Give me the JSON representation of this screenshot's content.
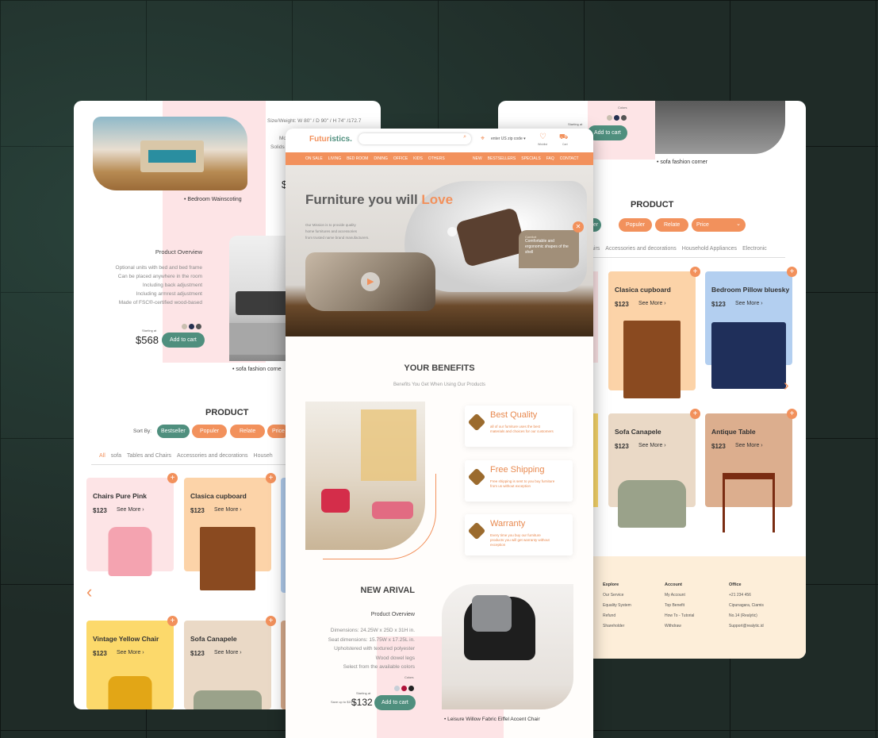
{
  "left": {
    "spec_text": "Size/Weight: W 80\" / D 90\" / H 74\" /172.7",
    "spec_partial_1": "Mo",
    "spec_partial_2": "Solids",
    "price_partial": "$",
    "bedroom_caption": "• Bedroom Wainscoting",
    "overview_title": "Product Overview",
    "overview_lines": [
      "Optional units with bed and bed frame",
      "Can be placed anywhere in the room",
      "Including back adjustment",
      "Including armrest adjustment",
      "Made of FSC®-certified wood-based"
    ],
    "starting_at": "Starting at",
    "price": "$568",
    "add_to_cart": "Add to cart",
    "sofa_caption": "• sofa fashion corne",
    "product_title": "PRODUCT",
    "sort_by": "Sort By:",
    "sort_buttons": [
      "Bestseller",
      "Populer",
      "Relate",
      "Price"
    ],
    "tabs": [
      "All",
      "sofa",
      "Tables and Chairs",
      "Accessories and decorations",
      "Househ"
    ],
    "products": [
      {
        "name": "Chairs Pure Pink",
        "price": "$123",
        "see": "See More ›"
      },
      {
        "name": "Clasica cupboard",
        "price": "$123",
        "see": "See More ›"
      },
      {
        "name": "Vintage Yellow Chair",
        "price": "$123",
        "see": "See More ›"
      },
      {
        "name": "Sofa Canapele",
        "price": "$123",
        "see": "See More ›"
      }
    ],
    "arrow": "‹"
  },
  "center": {
    "logo_a": "Futur",
    "logo_b": "istics.",
    "search_placeholder": "",
    "zip": "enter US zip code ▾",
    "wish_label": "Wishlist",
    "cart_label": "Cart",
    "nav_left": [
      "ON SALE",
      "LIVING",
      "BED ROOM",
      "DINING",
      "OFFICE",
      "KIDS",
      "OTHERS"
    ],
    "nav_right": [
      "NEW",
      "BESTSELLERS",
      "SPECIALS",
      "FAQ",
      "CONTACT"
    ],
    "hero_a": "Furniture you will ",
    "hero_b": "Love",
    "hero_desc": [
      "Our Mission is to provide quality",
      "home furnitures and accessories",
      "from trusted name brand manufacturers."
    ],
    "tooltip_title": "Comfort",
    "tooltip_text": "Comfortable and ergonomic shapes of the shell",
    "benefits_title": "YOUR BENEFITS",
    "benefits_sub": "Benefits You Get When Using Our Products",
    "benefits": [
      {
        "title": "Best Quality",
        "desc": "all of our furniture uses the best materials and choices for our customers"
      },
      {
        "title": "Free Shipping",
        "desc": "Free shipping is sent to you buy furniture from us without exception"
      },
      {
        "title": "Warranty",
        "desc": "Every time you buy our furniture products you will get warranty without exception"
      }
    ],
    "new_title": "NEW ARIVAL",
    "overview_title": "Product Overview",
    "overview_lines": [
      "Dimensions: 24.25W x 25D x 31H in.",
      "Seat dimensions: 15.75W x 17.25L in.",
      "Upholstered with textured polyester",
      "Wood dowel legs",
      "Select from the available colors"
    ],
    "colors_label": "Colors",
    "starting_at": "Starting at",
    "save_text": "Save up to $15",
    "price": "$132",
    "add_to_cart": "Add to cart",
    "chair_caption": "• Leisure Willow Fabric Eiffel Accent Chair"
  },
  "right": {
    "colors_label": "Colors",
    "starting_at": "Starting at",
    "add_to_cart": "Add to cart",
    "sofa_caption": "• sofa fashion corner",
    "product_title": "PRODUCT",
    "sort_buttons": [
      "stseller",
      "Populer",
      "Relate",
      "Price"
    ],
    "tabs": [
      "airs",
      "Accessories and decorations",
      "Household Appliances",
      "Electronic"
    ],
    "products": [
      {
        "name": "Clasica cupboard",
        "price": "$123",
        "see": "See More ›"
      },
      {
        "name": "Bedroom Pillow bluesky",
        "price": "$123",
        "see": "See More ›"
      },
      {
        "name": "Sofa Canapele",
        "price": "$123",
        "see": "See More ›"
      },
      {
        "name": "Antique Table",
        "price": "$123",
        "see": "See More ›"
      }
    ],
    "arrow": "›",
    "footer": {
      "explore": {
        "title": "Explore",
        "items": [
          "Our Service",
          "Equality System",
          "Refund",
          "Shareholder"
        ]
      },
      "account": {
        "title": "Account",
        "items": [
          "My Account",
          "Top Benefit",
          "How To - Tutorial",
          "Withdraw"
        ]
      },
      "office": {
        "title": "Office",
        "items": [
          "+21 234 456",
          "Cipunagara, Ciamis",
          "No.14 (Realytic)",
          "Support@realytic.id"
        ]
      }
    }
  },
  "colors": {
    "accent": "#f2915c",
    "teal": "#4f8f7e",
    "pink": "#fde4e6",
    "peach": "#fcd3a8",
    "yellow": "#fcd96b",
    "beige": "#ead9c6",
    "blue": "#b3cff0",
    "tan": "#dcae8e"
  }
}
